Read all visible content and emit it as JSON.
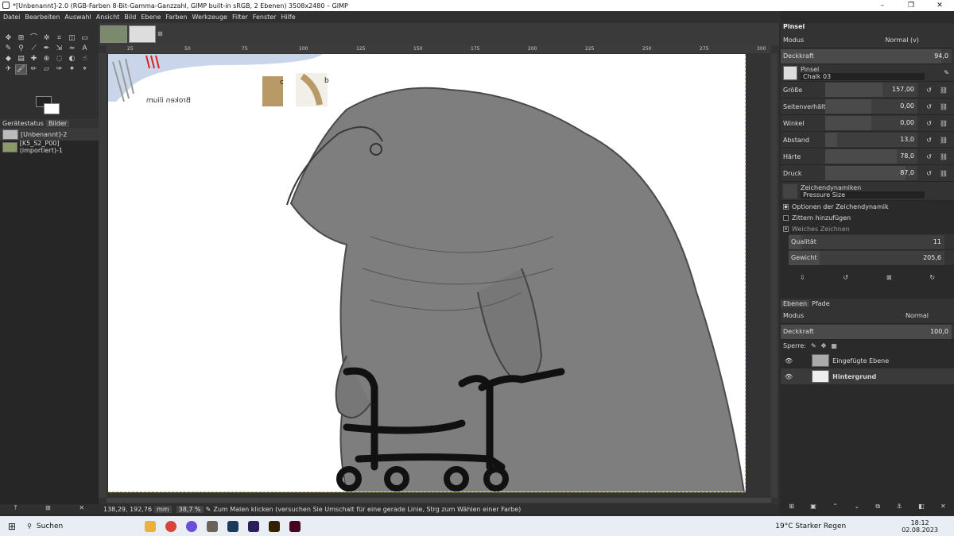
{
  "window": {
    "title": "*[Unbenannt]-2.0 (RGB-Farben 8-Bit-Gamma-Ganzzahl, GIMP built-in sRGB, 2 Ebenen) 3508x2480 – GIMP",
    "minimize": "–",
    "maximize": "❐",
    "close": "✕"
  },
  "menu": [
    "Datei",
    "Bearbeiten",
    "Auswahl",
    "Ansicht",
    "Bild",
    "Ebene",
    "Farben",
    "Werkzeuge",
    "Filter",
    "Fenster",
    "Hilfe"
  ],
  "left_panel": {
    "tabs": [
      "Gerätestatus",
      "Bilder"
    ],
    "images": [
      "[Unbenannt]-2",
      "[K5_S2_P00] (importiert)-1"
    ]
  },
  "ruler_ticks": [
    "25",
    "50",
    "75",
    "100",
    "125",
    "150",
    "175",
    "200",
    "225",
    "250",
    "275",
    "300"
  ],
  "canvas_labels": {
    "broken_ilium": "Broken ilium",
    "c": "c",
    "b": "b"
  },
  "status": {
    "coords": "138,29, 192,76",
    "unit": "mm",
    "zoom": "38,7 %",
    "hint": "Zum Malen klicken (versuchen Sie Umschalt für eine gerade Linie, Strg zum Wählen einer Farbe)"
  },
  "tool_options": {
    "title": "Pinsel",
    "mode_label": "Modus",
    "mode_value": "Normal (v)",
    "opacity_label": "Deckkraft",
    "opacity_value": "94,0",
    "brush_label": "Pinsel",
    "brush_value": "Chalk 03",
    "sliders": [
      {
        "label": "Größe",
        "value": "157,00",
        "fill": 0.62
      },
      {
        "label": "Seitenverhältnis",
        "value": "0,00",
        "fill": 0.5
      },
      {
        "label": "Winkel",
        "value": "0,00",
        "fill": 0.5
      },
      {
        "label": "Abstand",
        "value": "13,0",
        "fill": 0.13
      },
      {
        "label": "Härte",
        "value": "78,0",
        "fill": 0.78
      },
      {
        "label": "Druck",
        "value": "87,0",
        "fill": 0.87
      }
    ],
    "dynamics_label": "Zeichendynamiken",
    "dynamics_value": "Pressure Size",
    "checks": [
      {
        "label": "Optionen der Zeichendynamik",
        "mark": "◆"
      },
      {
        "label": "Zittern hinzufügen",
        "mark": ""
      },
      {
        "label": "Weiches Zeichnen",
        "mark": "✕"
      }
    ],
    "quality_label": "Qualität",
    "quality_value": "11",
    "weight_label": "Gewicht",
    "weight_value": "205,6"
  },
  "layers": {
    "tabs": [
      "Ebenen",
      "Pfade"
    ],
    "mode_label": "Modus",
    "mode_value": "Normal",
    "opacity_label": "Deckkraft",
    "opacity_value": "100,0",
    "lock_label": "Sperre:",
    "items": [
      {
        "name": "Eingefügte Ebene"
      },
      {
        "name": "Hintergrund"
      }
    ]
  },
  "taskbar": {
    "search": "Suchen",
    "weather": "19°C Starker Regen",
    "time": "18:12",
    "date": "02.08.2023"
  }
}
